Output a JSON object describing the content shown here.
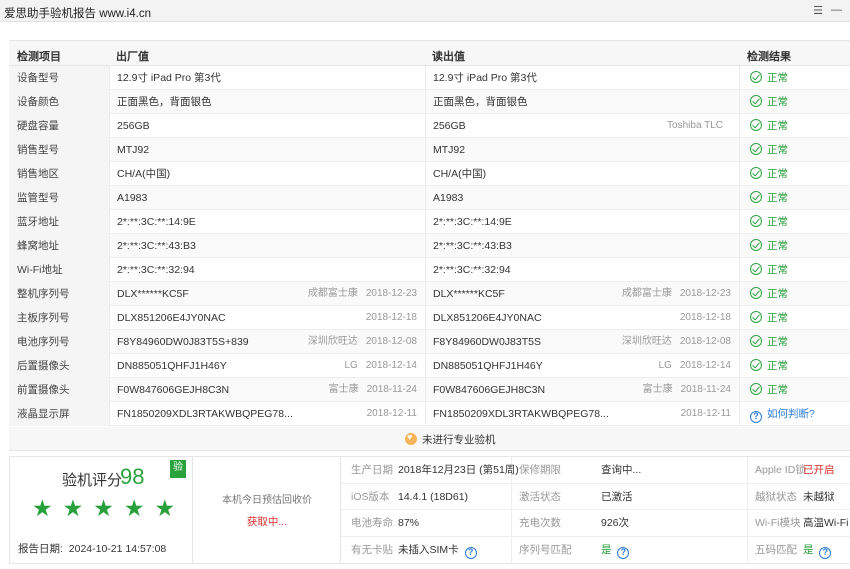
{
  "window": {
    "title": "爱思助手验机报告 www.i4.cn",
    "menu_icon": "list-icon",
    "minimize_icon": "minimize-icon"
  },
  "table": {
    "headers": {
      "item": "检测项目",
      "factory": "出厂值",
      "read": "读出值",
      "result": "检测结果"
    },
    "rows": [
      {
        "item": "设备型号",
        "factory": "12.9寸 iPad Pro 第3代",
        "factory_vendor": "",
        "factory_date": "",
        "read": "12.9寸 iPad Pro 第3代",
        "read_vendor": "",
        "read_date": "",
        "result": "正常",
        "status": "ok"
      },
      {
        "item": "设备颜色",
        "factory": "正面黑色，背面银色",
        "factory_vendor": "",
        "factory_date": "",
        "read": "正面黑色，背面银色",
        "read_vendor": "",
        "read_date": "",
        "result": "正常",
        "status": "ok"
      },
      {
        "item": "硬盘容量",
        "factory": "256GB",
        "factory_vendor": "",
        "factory_date": "",
        "read": "256GB",
        "read_vendor": "Toshiba TLC",
        "read_date": "",
        "result": "正常",
        "status": "ok"
      },
      {
        "item": "销售型号",
        "factory": "MTJ92",
        "factory_vendor": "",
        "factory_date": "",
        "read": "MTJ92",
        "read_vendor": "",
        "read_date": "",
        "result": "正常",
        "status": "ok"
      },
      {
        "item": "销售地区",
        "factory": "CH/A(中国)",
        "factory_vendor": "",
        "factory_date": "",
        "read": "CH/A(中国)",
        "read_vendor": "",
        "read_date": "",
        "result": "正常",
        "status": "ok"
      },
      {
        "item": "监管型号",
        "factory": "A1983",
        "factory_vendor": "",
        "factory_date": "",
        "read": "A1983",
        "read_vendor": "",
        "read_date": "",
        "result": "正常",
        "status": "ok"
      },
      {
        "item": "蓝牙地址",
        "factory": "2*:**:3C:**:14:9E",
        "factory_vendor": "",
        "factory_date": "",
        "read": "2*:**:3C:**:14:9E",
        "read_vendor": "",
        "read_date": "",
        "result": "正常",
        "status": "ok"
      },
      {
        "item": "蜂窝地址",
        "factory": "2*:**:3C:**:43:B3",
        "factory_vendor": "",
        "factory_date": "",
        "read": "2*:**:3C:**:43:B3",
        "read_vendor": "",
        "read_date": "",
        "result": "正常",
        "status": "ok"
      },
      {
        "item": "Wi-Fi地址",
        "factory": "2*:**:3C:**:32:94",
        "factory_vendor": "",
        "factory_date": "",
        "read": "2*:**:3C:**:32:94",
        "read_vendor": "",
        "read_date": "",
        "result": "正常",
        "status": "ok"
      },
      {
        "item": "整机序列号",
        "factory": "DLX******KC5F",
        "factory_vendor": "成都富士康",
        "factory_date": "2018-12-23",
        "read": "DLX******KC5F",
        "read_vendor": "成都富士康",
        "read_date": "2018-12-23",
        "result": "正常",
        "status": "ok"
      },
      {
        "item": "主板序列号",
        "factory": "DLX851206E4JY0NAC",
        "factory_vendor": "",
        "factory_date": "2018-12-18",
        "read": "DLX851206E4JY0NAC",
        "read_vendor": "",
        "read_date": "2018-12-18",
        "result": "正常",
        "status": "ok"
      },
      {
        "item": "电池序列号",
        "factory": "F8Y84960DW0J83T5S+839",
        "factory_vendor": "深圳欣旺达",
        "factory_date": "2018-12-08",
        "read": "F8Y84960DW0J83T5S",
        "read_vendor": "深圳欣旺达",
        "read_date": "2018-12-08",
        "result": "正常",
        "status": "ok"
      },
      {
        "item": "后置摄像头",
        "factory": "DN885051QHFJ1H46Y",
        "factory_vendor": "LG",
        "factory_date": "2018-12-14",
        "read": "DN885051QHFJ1H46Y",
        "read_vendor": "LG",
        "read_date": "2018-12-14",
        "result": "正常",
        "status": "ok"
      },
      {
        "item": "前置摄像头",
        "factory": "F0W847606GEJH8C3N",
        "factory_vendor": "富士康",
        "factory_date": "2018-11-24",
        "read": "F0W847606GEJH8C3N",
        "read_vendor": "富士康",
        "read_date": "2018-11-24",
        "result": "正常",
        "status": "ok"
      },
      {
        "item": "液晶显示屏",
        "factory": "FN1850209XDL3RTAKWBQPEG78...",
        "factory_vendor": "",
        "factory_date": "2018-12-11",
        "read": "FN1850209XDL3RTAKWBQPEG78...",
        "read_vendor": "",
        "read_date": "2018-12-11",
        "result": "如何判断?",
        "status": "help"
      }
    ],
    "pro_check": "未进行专业验机"
  },
  "summary": {
    "score_label": "验机评分",
    "score": "98",
    "badge": "验",
    "stars": 5,
    "report_date_label": "报告日期:",
    "report_date": "2024-10-21 14:57:08",
    "price_label": "本机今日预估回收价",
    "price_value": "获取中..."
  },
  "info": [
    [
      {
        "k": "生产日期",
        "v": "2018年12月23日 (第51周)",
        "style": ""
      },
      {
        "k": "保修期限",
        "v": "查询中...",
        "style": ""
      },
      {
        "k": "Apple ID锁",
        "v": "已开启",
        "style": "red"
      }
    ],
    [
      {
        "k": "iOS版本",
        "v": "14.4.1 (18D61)",
        "style": ""
      },
      {
        "k": "激活状态",
        "v": "已激活",
        "style": ""
      },
      {
        "k": "越狱状态",
        "v": "未越狱",
        "style": ""
      }
    ],
    [
      {
        "k": "电池寿命",
        "v": "87%",
        "style": ""
      },
      {
        "k": "充电次数",
        "v": "926次",
        "style": ""
      },
      {
        "k": "Wi-Fi模块",
        "v": "高温Wi-Fi",
        "style": ""
      }
    ],
    [
      {
        "k": "有无卡贴",
        "v": "未插入SIM卡",
        "style": "",
        "help": true
      },
      {
        "k": "序列号匹配",
        "v": "是",
        "style": "green",
        "help": true
      },
      {
        "k": "五码匹配",
        "v": "是",
        "style": "green",
        "help": true
      }
    ]
  ]
}
